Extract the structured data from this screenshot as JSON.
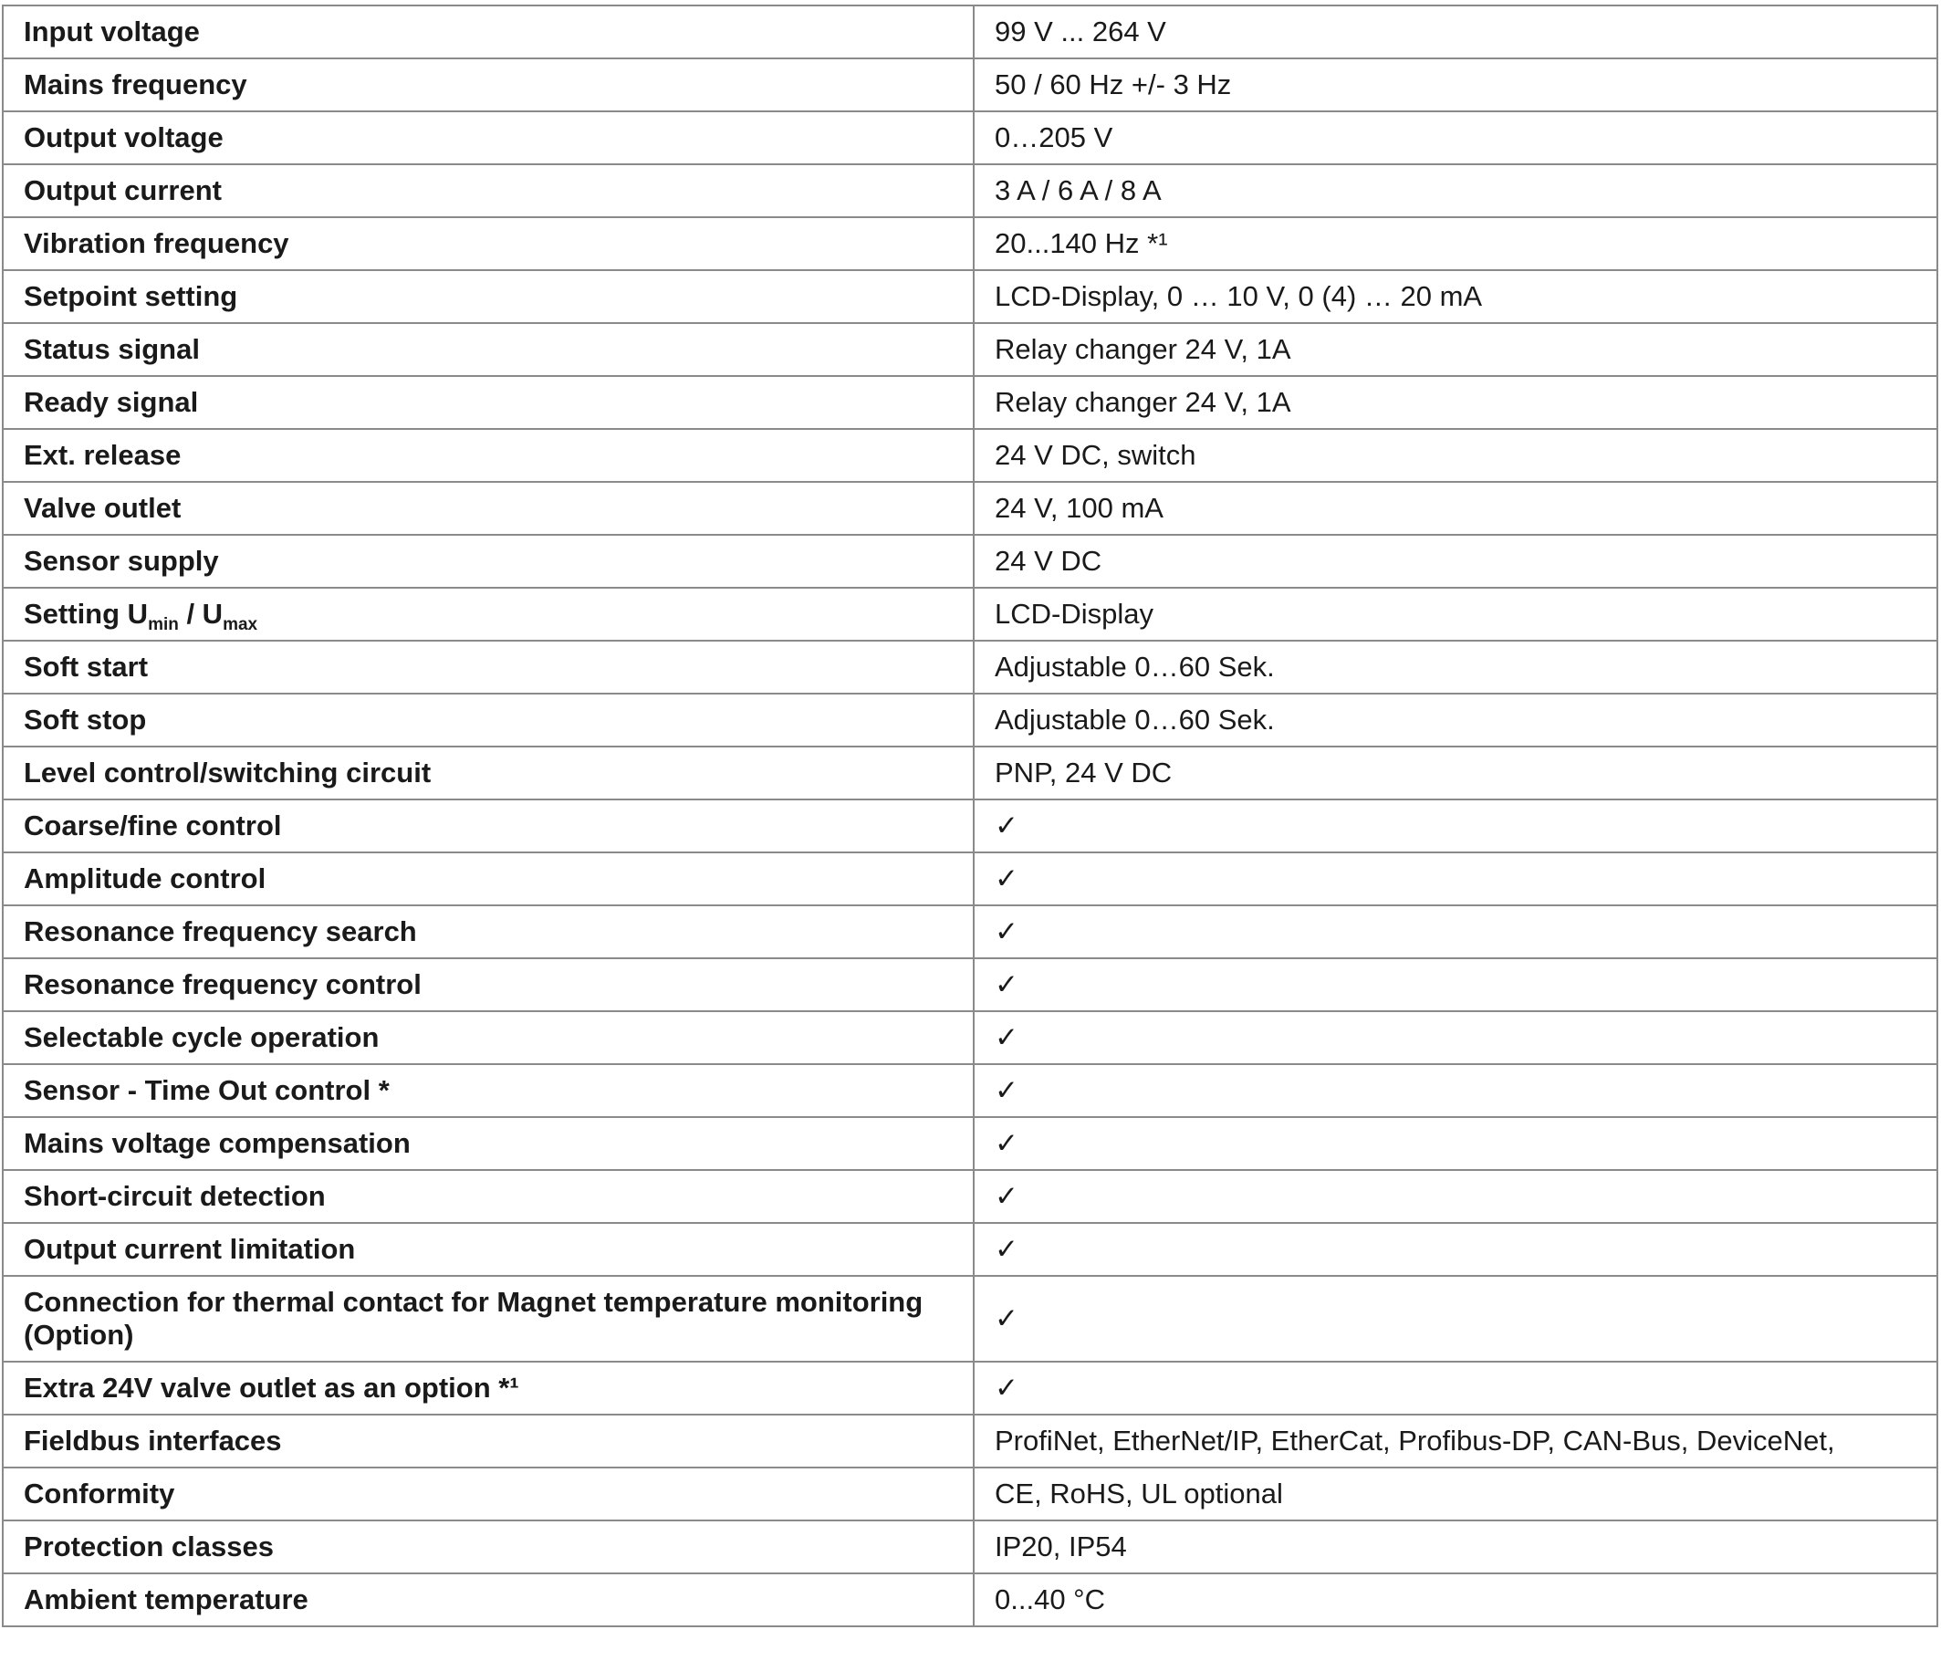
{
  "rows": [
    {
      "label": "Input voltage",
      "value": "99 V ... 264 V"
    },
    {
      "label": "Mains frequency",
      "value": "50 / 60 Hz +/- 3 Hz"
    },
    {
      "label": "Output voltage",
      "value": "0…205 V"
    },
    {
      "label": "Output current",
      "value": "3 A / 6 A / 8 A"
    },
    {
      "label": "Vibration frequency",
      "value": "20...140 Hz *¹"
    },
    {
      "label": "Setpoint setting",
      "value": "LCD-Display, 0 … 10 V, 0 (4) … 20 mA"
    },
    {
      "label": "Status signal",
      "value": "Relay changer 24 V, 1A"
    },
    {
      "label": "Ready signal",
      "value": "Relay changer 24 V, 1A"
    },
    {
      "label": "Ext. release",
      "value": "24 V DC, switch"
    },
    {
      "label": "Valve outlet",
      "value": "24 V, 100 mA"
    },
    {
      "label": "Sensor supply",
      "value": "24 V DC"
    },
    {
      "label": "Setting U",
      "label_sub1": "min",
      "label_mid": " / U",
      "label_sub2": "max",
      "value": "LCD-Display"
    },
    {
      "label": "Soft start",
      "value": "Adjustable 0…60 Sek."
    },
    {
      "label": "Soft stop",
      "value": "Adjustable 0…60 Sek."
    },
    {
      "label": "Level control/switching circuit",
      "value": "PNP, 24 V DC"
    },
    {
      "label": "Coarse/fine control",
      "value": "✓"
    },
    {
      "label": "Amplitude control",
      "value": "✓"
    },
    {
      "label": "Resonance frequency search",
      "value": "✓"
    },
    {
      "label": "Resonance frequency control",
      "value": "✓"
    },
    {
      "label": "Selectable cycle operation",
      "value": "✓"
    },
    {
      "label": "Sensor - Time Out control *",
      "value": "✓"
    },
    {
      "label": "Mains voltage compensation",
      "value": "✓"
    },
    {
      "label": "Short-circuit detection",
      "value": "✓"
    },
    {
      "label": "Output current limitation",
      "value": "✓"
    },
    {
      "label": "Connection for thermal contact for Magnet temperature monitoring (Option)",
      "value": "✓"
    },
    {
      "label": "Extra 24V valve outlet as an option *¹",
      "value": "✓"
    },
    {
      "label": "Fieldbus interfaces",
      "value": "ProfiNet, EtherNet/IP, EtherCat, Profibus-DP, CAN-Bus, DeviceNet,"
    },
    {
      "label": "Conformity",
      "value": "CE, RoHS, UL optional"
    },
    {
      "label": "Protection classes",
      "value": "IP20, IP54"
    },
    {
      "label": "Ambient temperature",
      "value": "0...40 °C"
    }
  ]
}
